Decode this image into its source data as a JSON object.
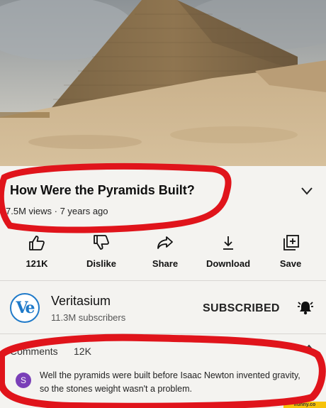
{
  "video": {
    "title": "How Were the Pyramids Built?",
    "meta": "7.5M views · 7 years ago"
  },
  "actions": [
    {
      "label": "121K",
      "icon": "thumbs-up-icon"
    },
    {
      "label": "Dislike",
      "icon": "thumbs-down-icon"
    },
    {
      "label": "Share",
      "icon": "share-icon"
    },
    {
      "label": "Download",
      "icon": "download-icon"
    },
    {
      "label": "Save",
      "icon": "save-to-playlist-icon"
    }
  ],
  "channel": {
    "avatar_text": "Ve",
    "name": "Veritasium",
    "subscribers": "11.3M subscribers",
    "subscribe_label": "SUBSCRIBED"
  },
  "comments": {
    "header": "Comments",
    "count": "12K",
    "top_comment": {
      "avatar_letter": "S",
      "text": "Well the pyramids were built before Isaac Newton invented gravity, so the stones weight wasn't a problem."
    }
  },
  "watermark": "ifunny.co",
  "colors": {
    "annotation_red": "#e0141b",
    "channel_blue": "#1f7ac9",
    "avatar_purple": "#7a3fb8"
  }
}
